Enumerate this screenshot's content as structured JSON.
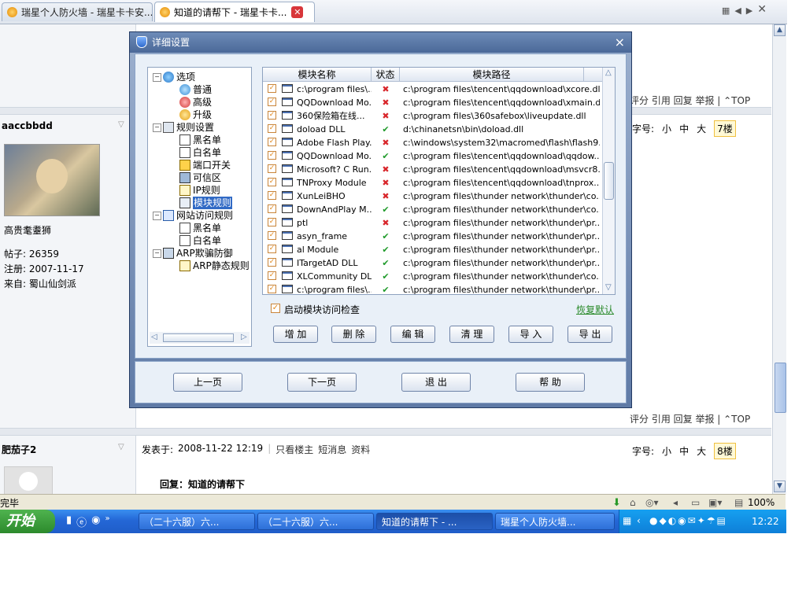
{
  "browser": {
    "tabs": [
      {
        "label": "瑞星个人防火墙 - 瑞星卡卡安..."
      },
      {
        "label": "知道的请帮下 - 瑞星卡卡..."
      }
    ],
    "scroll_up": "▲",
    "scroll_down": "▼"
  },
  "page": {
    "top_actions": "评分 引用 回复 举报 | ⌃TOP",
    "post1": {
      "author": "aaccbbdd",
      "nickname": "高贵耄耋狮",
      "posts_label": "帖子: 26359",
      "reg_label": "注册:  2007-11-17",
      "from_label": "来自: 蜀山仙剑派",
      "fontsize_label": "字号:",
      "fs_small": "小",
      "fs_mid": "中",
      "fs_big": "大",
      "floor": "7楼"
    },
    "mid_actions": "评分 引用 回复 举报 | ⌃TOP",
    "post2": {
      "author": "肥茄子2",
      "posted_label": "发表于: ",
      "posted_time": "2008-11-22 12:19",
      "only_author": "只看楼主",
      "sms": "短消息",
      "profile": "资料",
      "fontsize_label": "字号:",
      "fs_small": "小",
      "fs_mid": "中",
      "fs_big": "大",
      "floor": "8楼",
      "reply_title": "回复：知道的请帮下"
    }
  },
  "statusbar": {
    "text": "完毕",
    "zoom": "100%"
  },
  "taskbar": {
    "start": "开始",
    "tasks": [
      {
        "label": "（二十六服）六..."
      },
      {
        "label": "（二十六服）六..."
      },
      {
        "label": "知道的请帮下 - ..."
      },
      {
        "label": "瑞星个人防火墙..."
      }
    ],
    "clock": "12:22"
  },
  "dialog": {
    "title": "详细设置",
    "close": "×",
    "tree": [
      {
        "label": "选项",
        "icon": "options-icon"
      },
      {
        "label": "普通",
        "icon": "general-icon"
      },
      {
        "label": "高级",
        "icon": "advanced-icon"
      },
      {
        "label": "升级",
        "icon": "upgrade-icon"
      },
      {
        "label": "规则设置",
        "icon": "rules-icon"
      },
      {
        "label": "黑名单",
        "icon": "blacklist-icon"
      },
      {
        "label": "白名单",
        "icon": "whitelist-icon"
      },
      {
        "label": "端口开关",
        "icon": "port-icon"
      },
      {
        "label": "可信区",
        "icon": "trusted-zone-icon"
      },
      {
        "label": "IP规则",
        "icon": "ip-rule-icon"
      },
      {
        "label": "模块规则",
        "icon": "module-rule-icon"
      },
      {
        "label": "网站访问规则",
        "icon": "website-icon"
      },
      {
        "label": "黑名单",
        "icon": "blacklist-icon"
      },
      {
        "label": "白名单",
        "icon": "whitelist-icon"
      },
      {
        "label": "ARP欺骗防御",
        "icon": "arp-icon"
      },
      {
        "label": "ARP静态规则",
        "icon": "arp-static-icon"
      }
    ],
    "list_headers": {
      "name": "模块名称",
      "status": "状态",
      "path": "模块路径"
    },
    "list_rows": [
      {
        "name": "c:\\program files\\...",
        "status": "✖",
        "path": "c:\\program files\\tencent\\qqdownload\\xcore.dll"
      },
      {
        "name": "QQDownload Mo...",
        "status": "✖",
        "path": "c:\\program files\\tencent\\qqdownload\\xmain.dll"
      },
      {
        "name": "360保险箱在线...",
        "status": "✖",
        "path": "c:\\program files\\360safebox\\liveupdate.dll"
      },
      {
        "name": "doload DLL",
        "status": "✔",
        "path": "d:\\chinanetsn\\bin\\doload.dll"
      },
      {
        "name": "Adobe Flash Play...",
        "status": "✖",
        "path": "c:\\windows\\system32\\macromed\\flash\\flash9..."
      },
      {
        "name": "QQDownload Mo...",
        "status": "✔",
        "path": "c:\\program files\\tencent\\qqdownload\\qqdow..."
      },
      {
        "name": "Microsoft? C Run...",
        "status": "✖",
        "path": "c:\\program files\\tencent\\qqdownload\\msvcr8..."
      },
      {
        "name": "TNProxy Module",
        "status": "✖",
        "path": "c:\\program files\\tencent\\qqdownload\\tnprox..."
      },
      {
        "name": "XunLeiBHO",
        "status": "✖",
        "path": "c:\\program files\\thunder network\\thunder\\co..."
      },
      {
        "name": "DownAndPlay M...",
        "status": "✔",
        "path": "c:\\program files\\thunder network\\thunder\\co..."
      },
      {
        "name": "ptl",
        "status": "✖",
        "path": "c:\\program files\\thunder network\\thunder\\pr..."
      },
      {
        "name": "asyn_frame",
        "status": "✔",
        "path": "c:\\program files\\thunder network\\thunder\\pr..."
      },
      {
        "name": "al Module",
        "status": "✔",
        "path": "c:\\program files\\thunder network\\thunder\\pr..."
      },
      {
        "name": "ITargetAD DLL",
        "status": "✔",
        "path": "c:\\program files\\thunder network\\thunder\\pr..."
      },
      {
        "name": "XLCommunity DLL",
        "status": "✔",
        "path": "c:\\program files\\thunder network\\thunder\\co..."
      },
      {
        "name": "c:\\program files\\...",
        "status": "✔",
        "path": "c:\\program files\\thunder network\\thunder\\pr..."
      }
    ],
    "enable_check_label": "启动模块访问检查",
    "restore_default": "恢复默认",
    "buttons": {
      "add": "增 加",
      "delete": "删 除",
      "edit": "编 辑",
      "clean": "清 理",
      "import": "导 入",
      "export": "导 出"
    },
    "footer": {
      "prev": "上一页",
      "next": "下一页",
      "exit": "退 出",
      "help": "帮 助"
    }
  },
  "colors": {
    "ok": "#1f9a2a",
    "bad": "#d8262b",
    "selection": "#316ac5",
    "link_green": "#2a8a2a"
  }
}
